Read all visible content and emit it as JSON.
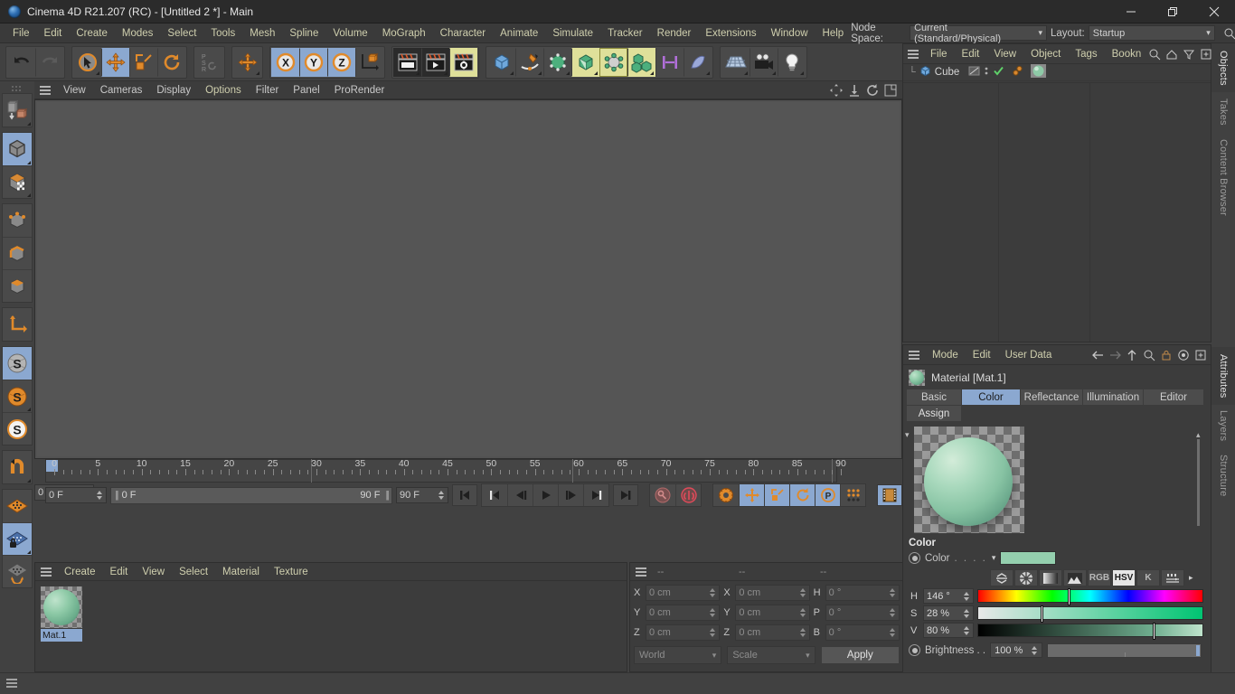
{
  "window": {
    "title": "Cinema 4D R21.207 (RC) - [Untitled 2 *] - Main",
    "app_icon": "cinema4d-logo-icon",
    "minimize": "minimize-icon",
    "maximize": "restore-icon",
    "close": "close-icon"
  },
  "menubar": {
    "items": [
      "File",
      "Edit",
      "Create",
      "Modes",
      "Select",
      "Tools",
      "Mesh",
      "Spline",
      "Volume",
      "MoGraph",
      "Character",
      "Animate",
      "Simulate",
      "Tracker",
      "Render",
      "Extensions",
      "Window",
      "Help"
    ],
    "node_space_label": "Node Space:",
    "node_space_value": "Current (Standard/Physical)",
    "layout_label": "Layout:",
    "layout_value": "Startup"
  },
  "toolbar": {
    "groups": [
      {
        "name": "history",
        "buttons": [
          {
            "name": "undo-button",
            "icon": "undo-arrow-icon",
            "state": "normal"
          },
          {
            "name": "redo-button",
            "icon": "redo-arrow-icon",
            "state": "disabled"
          }
        ]
      },
      {
        "name": "transform",
        "buttons": [
          {
            "name": "select-tool-button",
            "icon": "cursor-circle-icon",
            "state": "normal"
          },
          {
            "name": "move-tool-button",
            "icon": "move-arrows-icon",
            "state": "active"
          },
          {
            "name": "scale-tool-button",
            "icon": "scale-box-icon",
            "state": "normal"
          },
          {
            "name": "rotate-tool-button",
            "icon": "rotate-circle-icon",
            "state": "normal"
          }
        ]
      },
      {
        "name": "psr",
        "buttons": [
          {
            "name": "psr-lock-button",
            "icon": "psr-text-icon",
            "state": "normal"
          },
          {
            "name": "world-object-axis-button",
            "icon": "move-arrows-icon",
            "state": "normal"
          }
        ]
      },
      {
        "name": "axis-lock",
        "buttons": [
          {
            "name": "x-axis-lock-button",
            "icon": "x-axis-icon",
            "state": "active"
          },
          {
            "name": "y-axis-lock-button",
            "icon": "y-axis-icon",
            "state": "active"
          },
          {
            "name": "z-axis-lock-button",
            "icon": "z-axis-icon",
            "state": "active"
          },
          {
            "name": "coordinate-system-button",
            "icon": "axis-cube-icon",
            "state": "normal"
          }
        ]
      },
      {
        "name": "render",
        "buttons": [
          {
            "name": "render-view-button",
            "icon": "render-clapper-icon",
            "state": "normal"
          },
          {
            "name": "render-to-picture-viewer-button",
            "icon": "render-play-icon",
            "state": "normal"
          },
          {
            "name": "render-settings-button",
            "icon": "render-gear-icon",
            "state": "active-yellow"
          }
        ]
      },
      {
        "name": "objects",
        "buttons": [
          {
            "name": "add-cube-button",
            "icon": "blue-cube-icon",
            "state": "normal"
          },
          {
            "name": "add-spline-button",
            "icon": "pen-spline-icon",
            "state": "normal"
          },
          {
            "name": "add-generator-button",
            "icon": "green-cube-points-icon",
            "state": "normal"
          },
          {
            "name": "add-array-button",
            "icon": "green-cube-cut-icon",
            "state": "active-yellow"
          },
          {
            "name": "add-deformer-button",
            "icon": "atom-deformer-icon",
            "state": "active-yellow-border"
          },
          {
            "name": "add-cloner-button",
            "icon": "three-cubes-icon",
            "state": "active-yellow"
          },
          {
            "name": "add-field-button",
            "icon": "linear-field-icon",
            "state": "normal"
          },
          {
            "name": "add-effector-button",
            "icon": "bend-shape-icon",
            "state": "normal"
          }
        ]
      },
      {
        "name": "scene",
        "buttons": [
          {
            "name": "add-floor-button",
            "icon": "floor-grid-icon",
            "state": "normal"
          },
          {
            "name": "add-camera-button",
            "icon": "camera-icon",
            "state": "normal"
          },
          {
            "name": "add-light-button",
            "icon": "lightbulb-icon",
            "state": "normal"
          }
        ]
      }
    ]
  },
  "left_toolbar": {
    "buttons": [
      {
        "name": "make-editable-button",
        "icon": "make-editable-icon",
        "state": "normal"
      },
      {
        "name": "model-mode-button",
        "icon": "model-cube-icon",
        "state": "active"
      },
      {
        "name": "texture-mode-button",
        "icon": "texture-checker-cube-icon",
        "state": "normal"
      },
      {
        "name": "points-mode-button",
        "icon": "points-cube-icon",
        "state": "normal"
      },
      {
        "name": "edges-mode-button",
        "icon": "edges-cube-icon",
        "state": "normal"
      },
      {
        "name": "polygons-mode-button",
        "icon": "polygons-cube-icon",
        "state": "normal"
      },
      {
        "name": "axis-mode-button",
        "icon": "axis-arrows-icon",
        "state": "normal"
      },
      {
        "name": "enable-axis-button",
        "icon": "s-sphere-gray-icon",
        "state": "active"
      },
      {
        "name": "viewport-solo-button",
        "icon": "s-sphere-orange-icon",
        "state": "normal"
      },
      {
        "name": "viewport-solo-hierarchy-button",
        "icon": "s-sphere-white-icon",
        "state": "normal"
      },
      {
        "name": "enable-snapping-button",
        "icon": "magnet-icon",
        "state": "normal"
      },
      {
        "name": "workplane-button",
        "icon": "orange-grid-icon",
        "state": "normal"
      },
      {
        "name": "lock-workplane-button",
        "icon": "locked-grid-icon",
        "state": "active"
      },
      {
        "name": "planar-workplane-button",
        "icon": "grid-rotate-icon",
        "state": "normal"
      }
    ]
  },
  "viewport": {
    "menu": [
      "View",
      "Cameras",
      "Display",
      "Options",
      "Filter",
      "Panel",
      "ProRender"
    ],
    "highlighted_menu": "Options",
    "corner_icons": [
      "pan-icon",
      "dolly-icon",
      "rotate-icon",
      "maximize-view-icon"
    ]
  },
  "timeline": {
    "tick_labels": [
      "0",
      "5",
      "10",
      "15",
      "20",
      "25",
      "30",
      "35",
      "40",
      "45",
      "50",
      "55",
      "60",
      "65",
      "70",
      "75",
      "80",
      "85",
      "90"
    ],
    "start": 0,
    "end": 90,
    "current_frame_field": "0 F",
    "current_frame_field_right": "0 F",
    "range_start": "0 F",
    "range_end": "90 F",
    "max_frame_field": "90 F",
    "transport": [
      {
        "name": "go-to-start-button",
        "icon": "skip-start-icon"
      },
      {
        "name": "goto-start-button-2",
        "icon": "skip-start-icon"
      },
      {
        "name": "step-back-button",
        "icon": "step-back-icon"
      },
      {
        "name": "play-button",
        "icon": "play-icon"
      },
      {
        "name": "step-forward-button",
        "icon": "step-forward-icon"
      },
      {
        "name": "go-to-next-key-button",
        "icon": "next-key-icon"
      },
      {
        "name": "go-to-end-button",
        "icon": "skip-end-icon"
      }
    ],
    "record_buttons": [
      {
        "name": "record-active-objects-button",
        "icon": "key-icon",
        "state": "normal"
      },
      {
        "name": "autokeying-button",
        "icon": "record-circle-icon",
        "state": "normal"
      },
      {
        "name": "keyframe-settings-button",
        "icon": "gear-key-icon",
        "state": "normal"
      },
      {
        "name": "position-key-button",
        "icon": "move-arrows-icon",
        "state": "active"
      },
      {
        "name": "scale-key-button",
        "icon": "scale-box-icon",
        "state": "active"
      },
      {
        "name": "rotation-key-button",
        "icon": "rotate-circle-icon",
        "state": "active"
      },
      {
        "name": "parameter-key-button",
        "icon": "p-circle-icon",
        "state": "active"
      },
      {
        "name": "point-level-animation-button",
        "icon": "dots-grid-icon",
        "state": "normal"
      },
      {
        "name": "timeline-view-button",
        "icon": "filmstrip-icon",
        "state": "active"
      }
    ]
  },
  "material_manager": {
    "menu": [
      "Create",
      "Edit",
      "View",
      "Select",
      "Material",
      "Texture"
    ],
    "materials": [
      {
        "name": "Mat.1",
        "selected": true,
        "color": "#8ecaa7"
      }
    ]
  },
  "coordinates": {
    "header": [
      "--",
      "--",
      "--"
    ],
    "rows": [
      {
        "label_pos": "X",
        "value_pos": "0 cm",
        "label_size": "X",
        "value_size": "0 cm",
        "label_rot": "H",
        "value_rot": "0 °"
      },
      {
        "label_pos": "Y",
        "value_pos": "0 cm",
        "label_size": "Y",
        "value_size": "0 cm",
        "label_rot": "P",
        "value_rot": "0 °"
      },
      {
        "label_pos": "Z",
        "value_pos": "0 cm",
        "label_size": "Z",
        "value_size": "0 cm",
        "label_rot": "B",
        "value_rot": "0 °"
      }
    ],
    "coord_system": "World",
    "transform_mode": "Scale",
    "apply_label": "Apply"
  },
  "objects_panel": {
    "menu": [
      "File",
      "Edit",
      "View",
      "Object",
      "Tags",
      "Bookn"
    ],
    "icons": [
      "search-icon",
      "home-icon",
      "filter-icon",
      "add-panel-icon"
    ],
    "items": [
      {
        "name": "Cube",
        "icon": "blue-cube-icon",
        "tags": [
          "display-tag-icon",
          "visibility-dots-icon",
          "green-check-icon",
          "phong-tag-icon",
          "material-tag-icon"
        ]
      }
    ]
  },
  "attributes_panel": {
    "menu": [
      "Mode",
      "Edit",
      "User Data"
    ],
    "icons": [
      "back-arrow-icon",
      "forward-arrow-icon",
      "up-arrow-icon",
      "search-icon",
      "lock-icon",
      "target-icon",
      "add-panel-icon"
    ],
    "title": "Material [Mat.1]",
    "tabs": [
      "Basic",
      "Color",
      "Reflectance",
      "Illumination",
      "Editor"
    ],
    "selected_tab": "Color",
    "assign_label": "Assign",
    "section_title": "Color",
    "color_row_label": "Color",
    "color_dots": ". . . .",
    "color_swatch": "#94cfae",
    "color_modes": [
      {
        "name": "color-picker-mode-button",
        "icon": "arrows-collapse-icon",
        "selected": false
      },
      {
        "name": "color-wheel-mode-button",
        "icon": "color-wheel-icon",
        "selected": false
      },
      {
        "name": "color-gradient-mode-button",
        "icon": "gradient-icon",
        "selected": false
      },
      {
        "name": "color-spectrum-mode-button",
        "icon": "mountains-icon",
        "selected": false
      },
      {
        "name": "rgb-mode-button",
        "icon": "RGB",
        "label": "RGB",
        "selected": false
      },
      {
        "name": "hsv-mode-button",
        "icon": "HSV",
        "label": "HSV",
        "selected": true
      },
      {
        "name": "kelvin-mode-button",
        "icon": "K",
        "label": "K",
        "selected": false
      },
      {
        "name": "sliders-mode-button",
        "icon": "sliders-icon",
        "selected": false
      }
    ],
    "hsv": [
      {
        "label": "H",
        "value": "146 °",
        "knob_pct": 40
      },
      {
        "label": "S",
        "value": "28 %",
        "knob_pct": 28
      },
      {
        "label": "V",
        "value": "80 %",
        "knob_pct": 78
      }
    ],
    "brightness_label": "Brightness . .",
    "brightness_value": "100 %"
  },
  "vertical_tabs": {
    "top": [
      {
        "label": "Objects",
        "selected": true
      },
      {
        "label": "Takes",
        "selected": false
      },
      {
        "label": "Content Browser",
        "selected": false
      }
    ],
    "bottom": [
      {
        "label": "Attributes",
        "selected": true
      },
      {
        "label": "Layers",
        "selected": false
      },
      {
        "label": "Structure",
        "selected": false
      }
    ]
  },
  "colors": {
    "accent_blue": "#8ba8d0",
    "accent_yellow": "#dfe09a",
    "orange": "#e08a2b",
    "panel_bg": "#3c3c3c",
    "window_bg": "#414141"
  }
}
